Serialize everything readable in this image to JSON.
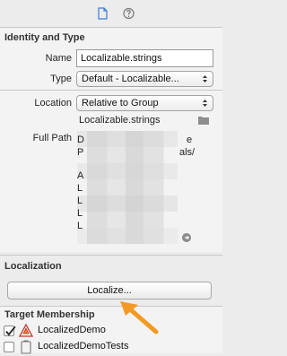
{
  "toolbar": {
    "tabs": [
      {
        "icon": "file-inspector-icon",
        "active": true
      },
      {
        "icon": "quick-help-icon",
        "active": false
      }
    ]
  },
  "identity": {
    "title": "Identity and Type",
    "name_label": "Name",
    "name_value": "Localizable.strings",
    "type_label": "Type",
    "type_value": "Default - Localizable...",
    "location_label": "Location",
    "location_value": "Relative to Group",
    "location_file": "Localizable.strings",
    "fullpath_label": "Full Path",
    "fullpath_visible_fragments": [
      "D",
      "e",
      "P",
      "als/",
      "A",
      "L",
      "L",
      "L",
      "L"
    ]
  },
  "localization": {
    "title": "Localization",
    "button_label": "Localize..."
  },
  "membership": {
    "title": "Target Membership",
    "targets": [
      {
        "label": "LocalizedDemo",
        "checked": true,
        "icon": "app-target-icon"
      },
      {
        "label": "LocalizedDemoTests",
        "checked": false,
        "icon": "test-bundle-icon"
      }
    ]
  },
  "colors": {
    "annotation_arrow": "#f39a24"
  }
}
